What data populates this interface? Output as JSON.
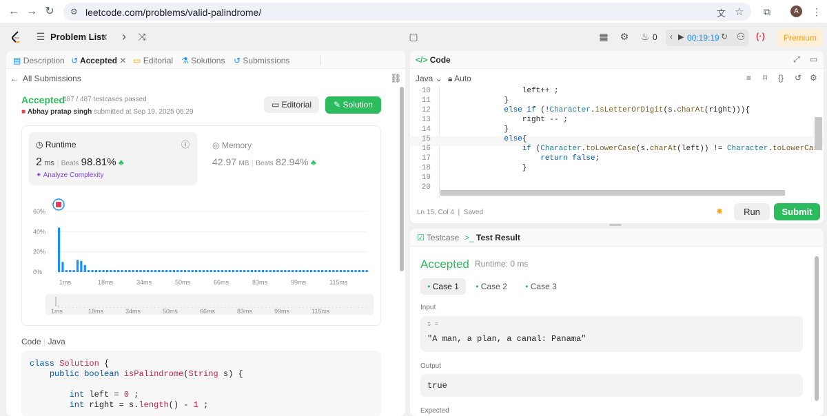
{
  "browser": {
    "url": "leetcode.com/problems/valid-palindrome/",
    "avatar": "A"
  },
  "appbar": {
    "problem_list": "Problem List",
    "coins": "0",
    "timer": "00:19:19",
    "premium": "Premium"
  },
  "left": {
    "tabs": [
      "Description",
      "Accepted",
      "Editorial",
      "Solutions",
      "Submissions"
    ],
    "all_submissions": "All Submissions",
    "status": "Accepted",
    "passed": "487 / 487 testcases passed",
    "author": "Abhay pratap singh",
    "submitted": "submitted at Sep 19, 2025 06:29",
    "editorial_btn": "Editorial",
    "solution_btn": "Solution",
    "runtime": {
      "label": "Runtime",
      "value": "2",
      "unit": "ms",
      "beats_label": "Beats",
      "beats": "98.81%"
    },
    "memory": {
      "label": "Memory",
      "value": "42.97",
      "unit": "MB",
      "beats_label": "Beats",
      "beats": "82.94%"
    },
    "analyze": "Analyze Complexity",
    "code_label": "Code",
    "code_lang": "Java",
    "code_lines": [
      "class Solution {",
      "    public boolean isPalindrome(String s) {",
      "",
      "        int left = 0 ;",
      "        int right = s.length() - 1 ;"
    ]
  },
  "chart_data": {
    "type": "bar",
    "yticks": [
      "60%",
      "40%",
      "20%",
      "0%"
    ],
    "xticks": [
      "1ms",
      "18ms",
      "34ms",
      "50ms",
      "66ms",
      "83ms",
      "99ms",
      "115ms"
    ],
    "ylim": [
      0,
      60
    ],
    "values": [
      44,
      10,
      2,
      2,
      2,
      12,
      11,
      7,
      2,
      2,
      2,
      2,
      2,
      2,
      2,
      2,
      2,
      2,
      2,
      2,
      2,
      2,
      2,
      2,
      2,
      2,
      2,
      2,
      2,
      2,
      2,
      2,
      2,
      2,
      2,
      2,
      2,
      2,
      2,
      2,
      2,
      2,
      2,
      2,
      2,
      2,
      2,
      2,
      2,
      2,
      2,
      2,
      2,
      2,
      2,
      2,
      2,
      2,
      2,
      2,
      2,
      2,
      2,
      2,
      2,
      2,
      2,
      2,
      2,
      2,
      2,
      2,
      2,
      2,
      2,
      2,
      2,
      2,
      2,
      2,
      2,
      2,
      2,
      2
    ],
    "highlight_index": 0,
    "bar_color": "#1a90ff"
  },
  "right": {
    "code_tab": "Code",
    "lang": "Java",
    "mode": "Auto",
    "line_nums": [
      "10",
      "11",
      "12",
      "13",
      "14",
      "15",
      "16",
      "17",
      "18",
      "19",
      "20"
    ],
    "status": "Ln 15, Col 4",
    "saved": "Saved",
    "run": "Run",
    "submit": "Submit",
    "testcase_tab": "Testcase",
    "result_tab": "Test Result",
    "result": "Accepted",
    "result_runtime": "Runtime: 0 ms",
    "cases": [
      "Case 1",
      "Case 2",
      "Case 3"
    ],
    "input_label": "Input",
    "var": "s =",
    "input_value": "\"A man, a plan, a canal: Panama\"",
    "output_label": "Output",
    "output_value": "true",
    "expected_label": "Expected"
  }
}
